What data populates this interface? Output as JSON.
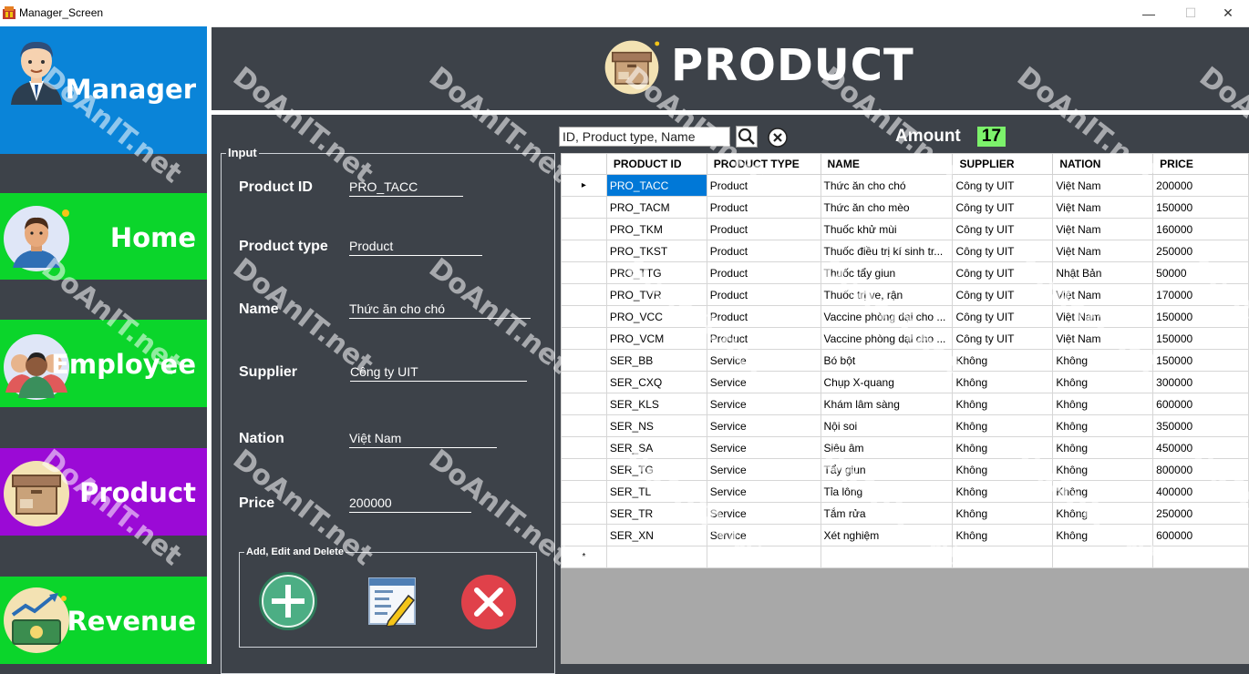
{
  "window": {
    "title": "Manager_Screen",
    "minimize_glyph": "—",
    "maximize_glyph": "☐",
    "close_glyph": "✕"
  },
  "sidebar": {
    "items": [
      {
        "label": "Manager",
        "color": "#0a84d8",
        "icon": "manager-avatar-icon"
      },
      {
        "label": "Home",
        "color": "#0bd52b",
        "icon": "home-avatar-icon"
      },
      {
        "label": "Employee",
        "color": "#0bd52b",
        "icon": "employee-group-icon"
      },
      {
        "label": "Product",
        "color": "#9b0ad6",
        "icon": "product-box-icon"
      },
      {
        "label": "Revenue",
        "color": "#0bd52b",
        "icon": "revenue-chart-icon"
      }
    ]
  },
  "header": {
    "title": "PRODUCT",
    "icon": "product-box-icon"
  },
  "input": {
    "legend": "Input",
    "fields": {
      "product_id": {
        "label": "Product ID",
        "value": "PRO_TACC"
      },
      "product_type": {
        "label": "Product type",
        "value": "Product"
      },
      "name": {
        "label": "Name",
        "value": "Thức ăn cho chó"
      },
      "supplier": {
        "label": "Supplier",
        "value": "Công ty UIT"
      },
      "nation": {
        "label": "Nation",
        "value": "Việt Nam"
      },
      "price": {
        "label": "Price",
        "value": "200000"
      }
    },
    "actions_legend": "Add, Edit and Delete"
  },
  "search": {
    "placeholder": "ID, Product type, Name"
  },
  "amount": {
    "label": "Amount",
    "value": "17"
  },
  "table": {
    "columns": [
      "PRODUCT ID",
      "PRODUCT TYPE",
      "NAME",
      "SUPPLIER",
      "NATION",
      "PRICE"
    ],
    "rows": [
      [
        "PRO_TACC",
        "Product",
        "Thức ăn cho chó",
        "Công ty UIT",
        "Việt Nam",
        "200000"
      ],
      [
        "PRO_TACM",
        "Product",
        "Thức ăn cho mèo",
        "Công ty UIT",
        "Việt Nam",
        "150000"
      ],
      [
        "PRO_TKM",
        "Product",
        "Thuốc khử mùi",
        "Công ty UIT",
        "Việt Nam",
        "160000"
      ],
      [
        "PRO_TKST",
        "Product",
        "Thuốc điều trị kí sinh tr...",
        "Công ty UIT",
        "Việt Nam",
        "250000"
      ],
      [
        "PRO_TTG",
        "Product",
        "Thuốc tẩy giun",
        "Công ty UIT",
        "Nhật Bản",
        "50000"
      ],
      [
        "PRO_TVR",
        "Product",
        "Thuốc trị ve, rận",
        "Công ty UIT",
        "Việt Nam",
        "170000"
      ],
      [
        "PRO_VCC",
        "Product",
        "Vaccine phòng dại cho ...",
        "Công ty UIT",
        "Việt Nam",
        "150000"
      ],
      [
        "PRO_VCM",
        "Product",
        "Vaccine phòng dại cho ...",
        "Công ty UIT",
        "Việt Nam",
        "150000"
      ],
      [
        "SER_BB",
        "Service",
        "Bó bột",
        "Không",
        "Không",
        "150000"
      ],
      [
        "SER_CXQ",
        "Service",
        "Chụp X-quang",
        "Không",
        "Không",
        "300000"
      ],
      [
        "SER_KLS",
        "Service",
        "Khám lâm sàng",
        "Không",
        "Không",
        "600000"
      ],
      [
        "SER_NS",
        "Service",
        "Nội soi",
        "Không",
        "Không",
        "350000"
      ],
      [
        "SER_SA",
        "Service",
        "Siêu âm",
        "Không",
        "Không",
        "450000"
      ],
      [
        "SER_TG",
        "Service",
        "Tẩy giun",
        "Không",
        "Không",
        "800000"
      ],
      [
        "SER_TL",
        "Service",
        "Tỉa lông",
        "Không",
        "Không",
        "400000"
      ],
      [
        "SER_TR",
        "Service",
        "Tắm rửa",
        "Không",
        "Không",
        "250000"
      ],
      [
        "SER_XN",
        "Service",
        "Xét nghiệm",
        "Không",
        "Không",
        "600000"
      ]
    ],
    "current_row_marker": "▸",
    "new_row_marker": "*"
  },
  "watermark": {
    "text": "DoAnIT.net"
  },
  "colors": {
    "background": "#3d4249",
    "selection": "#0078d7",
    "amount_badge": "#7cf26b"
  }
}
